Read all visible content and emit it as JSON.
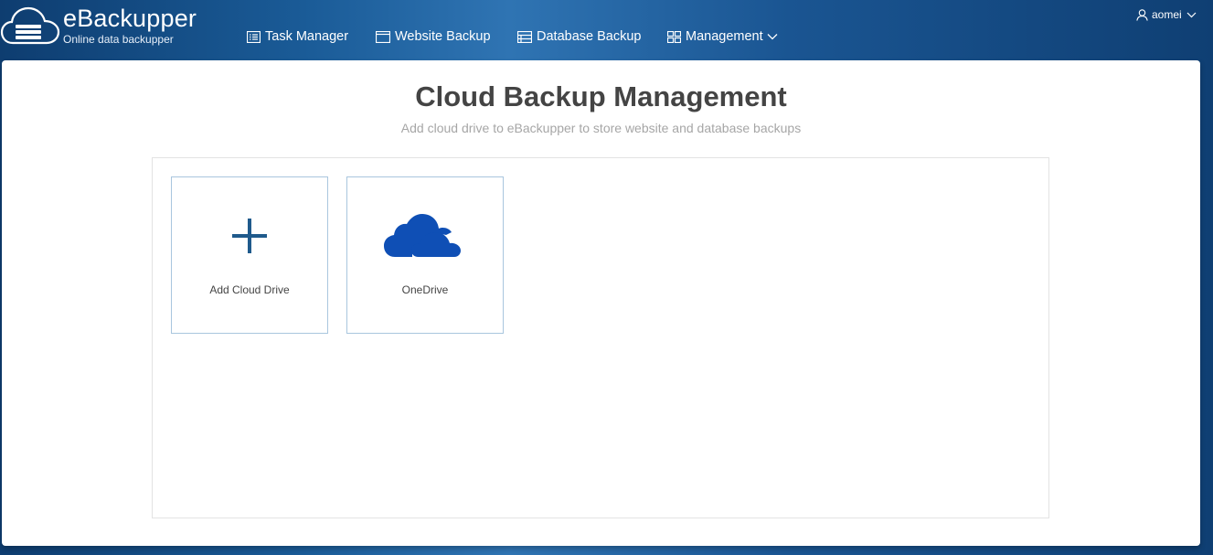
{
  "app": {
    "name": "eBackupper",
    "tagline": "Online data backupper",
    "logo_icon": "cloud-server-icon"
  },
  "nav": {
    "items": [
      {
        "label": "Task Manager",
        "icon": "list-icon"
      },
      {
        "label": "Website Backup",
        "icon": "browser-window-icon"
      },
      {
        "label": "Database Backup",
        "icon": "database-table-icon"
      },
      {
        "label": "Management",
        "icon": "grid-icon",
        "has_dropdown": true
      }
    ]
  },
  "user": {
    "name": "aomei",
    "icon": "user-icon"
  },
  "page": {
    "title": "Cloud Backup Management",
    "subtitle": "Add cloud drive to eBackupper to store website and database backups"
  },
  "drives": [
    {
      "label": "Add Cloud Drive",
      "icon": "plus-icon"
    },
    {
      "label": "OneDrive",
      "icon": "onedrive-cloud-icon"
    }
  ],
  "colors": {
    "header_dark": "#0e3d70",
    "header_light": "#2f74b3",
    "card_border": "#a9c6de",
    "plus_icon": "#1f5a8c",
    "onedrive_blue": "#0f4fb5"
  }
}
